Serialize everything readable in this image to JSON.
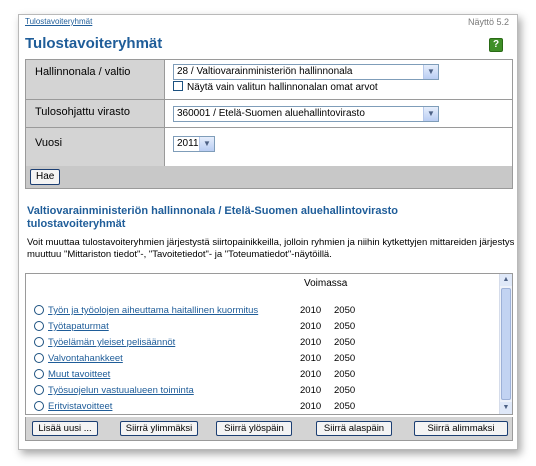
{
  "breadcrumb": "Tulostavoiteryhmät",
  "screen_number": "Näyttö 5.2",
  "title": "Tulostavoiteryhmät",
  "help_label": "?",
  "form": {
    "field_admin_label": "Hallinnonala / valtio",
    "field_admin_value": "28 / Valtiovarainministeriön hallinnonala",
    "checkbox_label": "Näytä vain valitun hallinnonalan omat arvot",
    "field_agency_label": "Tulosohjattu virasto",
    "field_agency_value": "360001 / Etelä-Suomen aluehallintovirasto",
    "field_year_label": "Vuosi",
    "field_year_value": "2011",
    "search_button": "Hae"
  },
  "subtitle": "Valtiovarainministeriön hallinnonala / Etelä-Suomen aluehallintovirasto tulostavoiteryhmät",
  "description": "Voit muuttaa tulostavoiteryhmien järjestystä siirtopainikkeilla, jolloin ryhmien ja niihin kytkettyjen mittareiden järjestys muuttuu \"Mittariston tiedot\"-, \"Tavoitetiedot\"- ja \"Toteumatiedot\"-näytöillä.",
  "list": {
    "header_valid": "Voimassa",
    "rows": [
      {
        "name": "Työn ja työolojen aiheuttama haitallinen kuormitus",
        "from": "2010",
        "to": "2050"
      },
      {
        "name": "Työtapaturmat",
        "from": "2010",
        "to": "2050"
      },
      {
        "name": "Työelämän yleiset pelisäännöt",
        "from": "2010",
        "to": "2050"
      },
      {
        "name": "Valvontahankkeet",
        "from": "2010",
        "to": "2050"
      },
      {
        "name": "Muut tavoitteet",
        "from": "2010",
        "to": "2050"
      },
      {
        "name": "Työsuojelun vastuualueen toiminta",
        "from": "2010",
        "to": "2050"
      },
      {
        "name": "Eritvistavoitteet",
        "from": "2010",
        "to": "2050"
      }
    ]
  },
  "buttons": {
    "add_new": "Lisää uusi ...",
    "move_top": "Siirrä ylimmäksi",
    "move_up": "Siirrä ylöspäin",
    "move_down": "Siirrä alaspäin",
    "move_bottom": "Siirrä alimmaksi"
  },
  "icons": {
    "dropdown": "chevron-down-icon",
    "scroll_up": "scroll-up-arrow-icon",
    "scroll_down": "scroll-down-arrow-icon",
    "help": "help-icon"
  },
  "colors": {
    "title_blue": "#1f5d99",
    "help_green": "#3f8f27",
    "panel_gray": "#d4d4d4"
  }
}
